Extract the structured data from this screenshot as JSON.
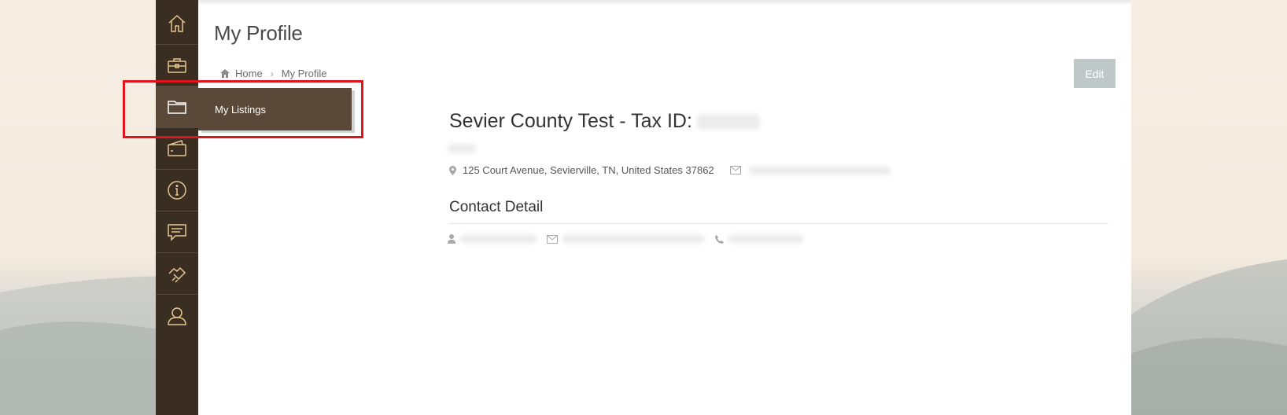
{
  "sidebar": {
    "items": [
      {
        "icon": "home-icon"
      },
      {
        "icon": "briefcase-icon"
      },
      {
        "icon": "folder-icon",
        "tooltip": "My Listings"
      },
      {
        "icon": "wallet-icon"
      },
      {
        "icon": "info-icon"
      },
      {
        "icon": "chat-icon"
      },
      {
        "icon": "handshake-icon"
      },
      {
        "icon": "user-icon"
      }
    ]
  },
  "page": {
    "title": "My Profile",
    "breadcrumb": {
      "home": "Home",
      "current": "My Profile"
    },
    "edit_label": "Edit"
  },
  "profile": {
    "title": "Sevier County Test - Tax ID:",
    "address": "125 Court Avenue, Sevierville, TN, United States 37862",
    "contact_heading": "Contact Detail"
  },
  "colors": {
    "sidebar_bg": "#3a2e22",
    "active_bg": "#5a4939",
    "icon_stroke": "#e6c690",
    "edit_bg": "#bfc8c9",
    "highlight": "#e0141a"
  }
}
